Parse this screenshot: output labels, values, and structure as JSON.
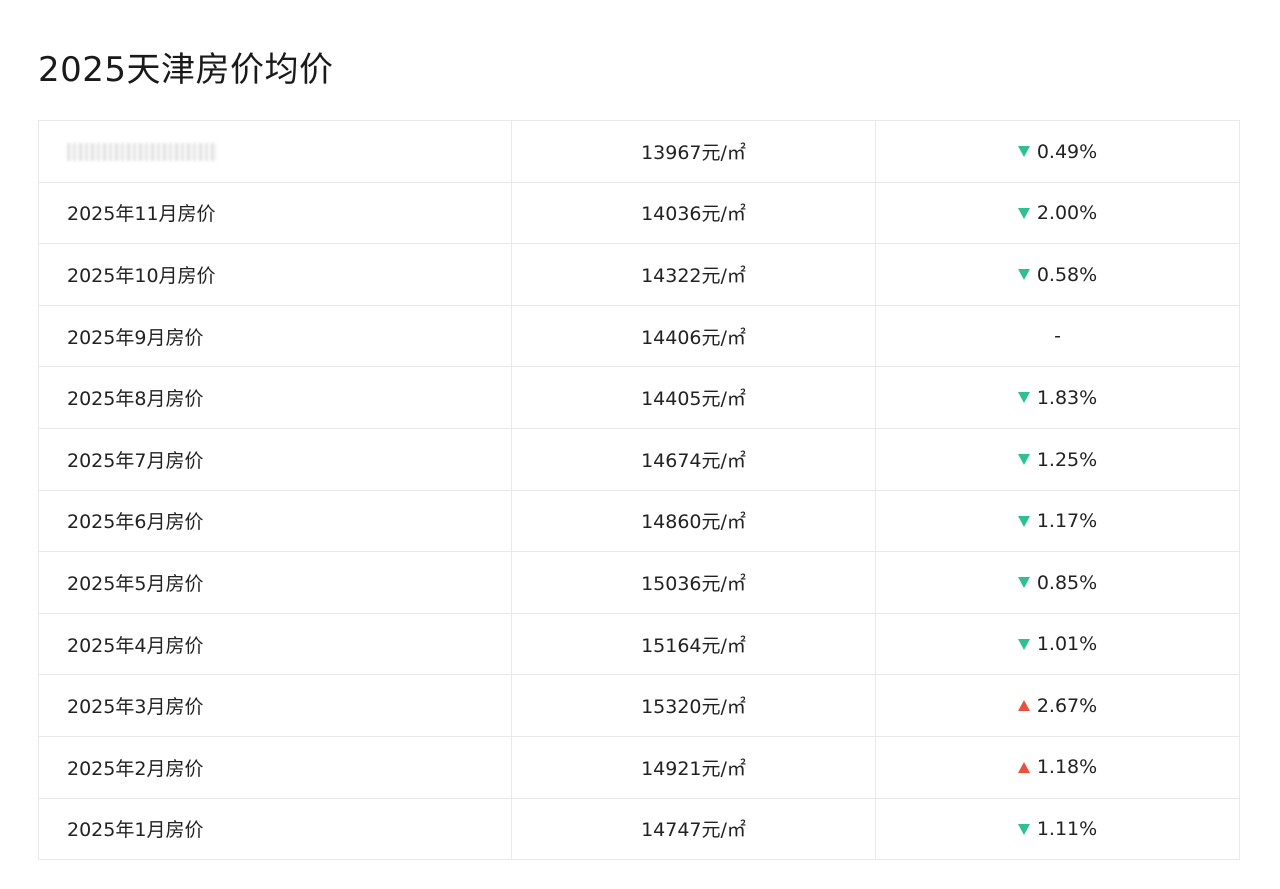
{
  "page": {
    "title": "2025天津房价均价"
  },
  "colors": {
    "down": "#2ec08e",
    "up": "#e8503f"
  },
  "rows": [
    {
      "month": "",
      "price": "13967元/㎡",
      "direction": "down",
      "change": "0.49%"
    },
    {
      "month": "2025年11月房价",
      "price": "14036元/㎡",
      "direction": "down",
      "change": "2.00%"
    },
    {
      "month": "2025年10月房价",
      "price": "14322元/㎡",
      "direction": "down",
      "change": "0.58%"
    },
    {
      "month": "2025年9月房价",
      "price": "14406元/㎡",
      "direction": "none",
      "change": "-"
    },
    {
      "month": "2025年8月房价",
      "price": "14405元/㎡",
      "direction": "down",
      "change": "1.83%"
    },
    {
      "month": "2025年7月房价",
      "price": "14674元/㎡",
      "direction": "down",
      "change": "1.25%"
    },
    {
      "month": "2025年6月房价",
      "price": "14860元/㎡",
      "direction": "down",
      "change": "1.17%"
    },
    {
      "month": "2025年5月房价",
      "price": "15036元/㎡",
      "direction": "down",
      "change": "0.85%"
    },
    {
      "month": "2025年4月房价",
      "price": "15164元/㎡",
      "direction": "down",
      "change": "1.01%"
    },
    {
      "month": "2025年3月房价",
      "price": "15320元/㎡",
      "direction": "up",
      "change": "2.67%"
    },
    {
      "month": "2025年2月房价",
      "price": "14921元/㎡",
      "direction": "up",
      "change": "1.18%"
    },
    {
      "month": "2025年1月房价",
      "price": "14747元/㎡",
      "direction": "down",
      "change": "1.11%"
    }
  ]
}
